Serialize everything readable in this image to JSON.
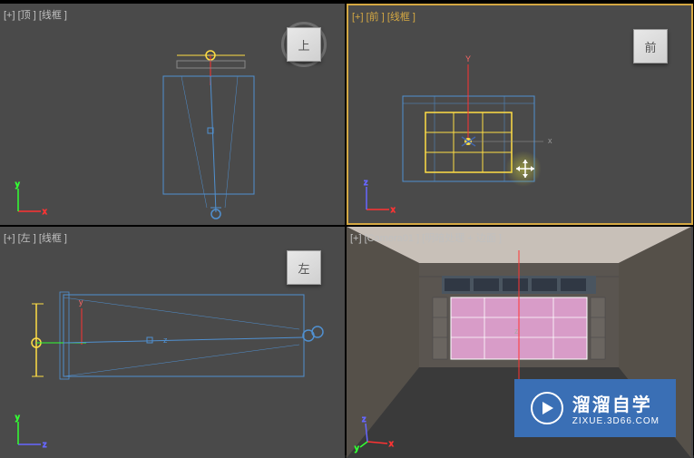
{
  "viewports": {
    "top": {
      "label": "[+] [顶 ] [线框 ]",
      "cube_label": "上",
      "axes": [
        "x",
        "y"
      ]
    },
    "front": {
      "label": "[+] [前 ] [线框 ]",
      "cube_label": "前",
      "active": true,
      "axes": [
        "x",
        "z"
      ]
    },
    "left": {
      "label": "[+] [左 ] [线框 ]",
      "cube_label": "左",
      "axes": [
        "z",
        "y"
      ]
    },
    "camera": {
      "label": "[+] [Camera01 ] [明暗处理 + 边面 ]",
      "axes": [
        "x",
        "y",
        "z"
      ]
    }
  },
  "front_axes": {
    "y_label": "Y",
    "x_label": "x"
  },
  "camera_axes": {
    "z_label": "z"
  },
  "watermark": {
    "title": "溜溜自学",
    "url": "ZIXUE.3D66.COM"
  },
  "colors": {
    "selected": "#ffdd44",
    "wireframe_blue": "#5090d0",
    "camera_icon": "#5090d0",
    "background": "#4a4a4a"
  }
}
